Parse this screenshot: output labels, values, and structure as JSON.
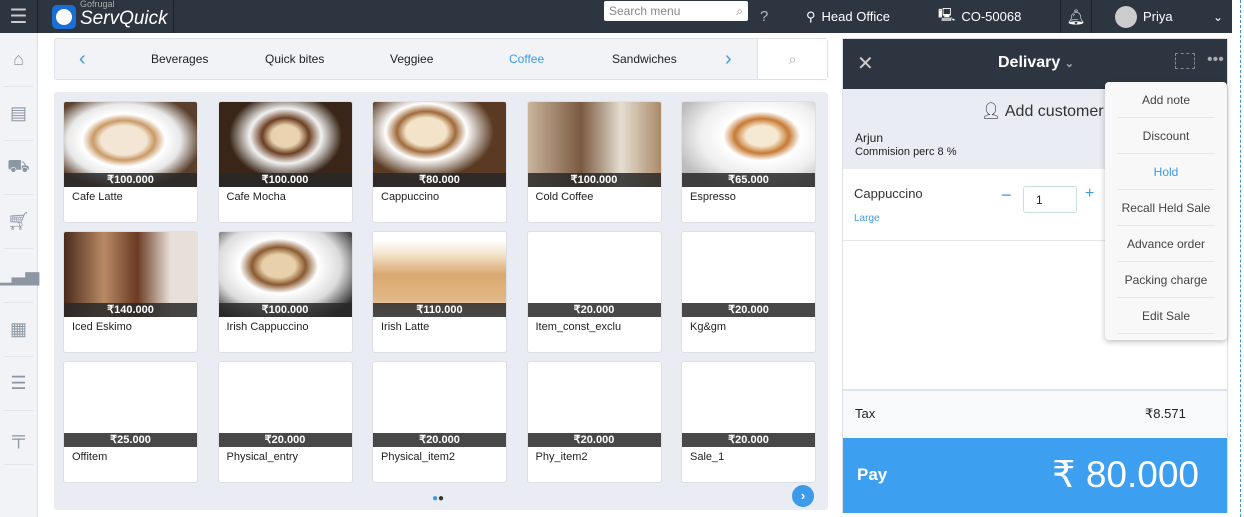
{
  "topbar": {
    "brand_small": "Gofrugal",
    "brand": "ServQuick",
    "search_placeholder": "Search menu",
    "location": "Head Office",
    "counter": "CO-50068",
    "user": "Priya"
  },
  "sidebar": {
    "icons": [
      "home-icon",
      "orders-icon",
      "delivery-trolley-icon",
      "cart-icon",
      "reports-icon",
      "calculator-icon",
      "settings-sliders-icon",
      "table-icon"
    ]
  },
  "categories": {
    "items": [
      "Beverages",
      "Quick bites",
      "Veggiee",
      "Coffee",
      "Sandwiches"
    ],
    "active": "Coffee"
  },
  "products": [
    {
      "name": "Cafe Latte",
      "price": "₹100.000",
      "image": "latte"
    },
    {
      "name": "Cafe Mocha",
      "price": "₹100.000",
      "image": "mocha"
    },
    {
      "name": "Cappuccino",
      "price": "₹80.000",
      "image": "cappuccino"
    },
    {
      "name": "Cold Coffee",
      "price": "₹100.000",
      "image": "cold-coffee"
    },
    {
      "name": "Espresso",
      "price": "₹65.000",
      "image": "espresso"
    },
    {
      "name": "Iced Eskimo",
      "price": "₹140.000",
      "image": "iced-eskimo"
    },
    {
      "name": "Irish Cappuccino",
      "price": "₹100.000",
      "image": "irish-cappuccino"
    },
    {
      "name": "Irish Latte",
      "price": "₹110.000",
      "image": "irish-latte"
    },
    {
      "name": "Item_const_exclu",
      "price": "₹20.000",
      "image": ""
    },
    {
      "name": "Kg&gm",
      "price": "₹20.000",
      "image": ""
    },
    {
      "name": "Offitem",
      "price": "₹25.000",
      "image": ""
    },
    {
      "name": "Physical_entry",
      "price": "₹20.000",
      "image": ""
    },
    {
      "name": "Physical_item2",
      "price": "₹20.000",
      "image": ""
    },
    {
      "name": "Phy_item2",
      "price": "₹20.000",
      "image": ""
    },
    {
      "name": "Sale_1",
      "price": "₹20.000",
      "image": ""
    }
  ],
  "order": {
    "type": "Delivary",
    "add_customer": "Add customer",
    "customer_name": "Arjun",
    "commission": "Commision perc 8 %",
    "line": {
      "name": "Cappuccino",
      "variant": "Large",
      "qty": "1"
    },
    "tax_label": "Tax",
    "tax_value": "₹8.571",
    "pay_label": "Pay",
    "pay_value": "₹ 80.000"
  },
  "menu": {
    "items": [
      "Add note",
      "Discount",
      "Hold",
      "Recall Held Sale",
      "Advance order",
      "Packing charge",
      "Edit Sale"
    ],
    "highlighted": "Hold"
  },
  "colors": {
    "accent": "#3d9be9",
    "topbar": "#2d3540"
  }
}
